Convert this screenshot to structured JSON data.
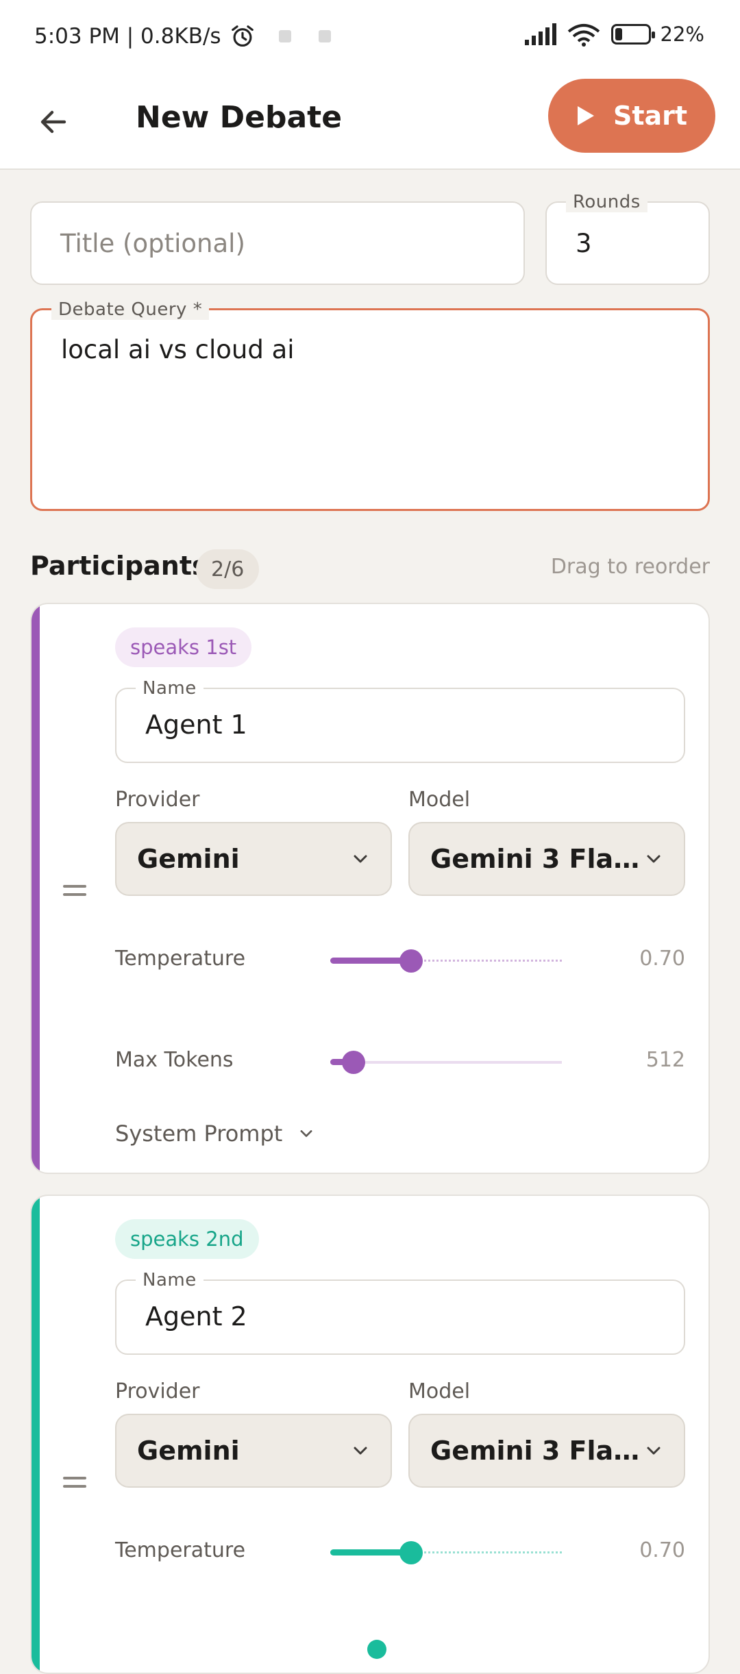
{
  "status_bar": {
    "time_text": "5:03 PM | 0.8KB/s",
    "battery_text": "22%",
    "battery_level": 0.22
  },
  "header": {
    "title": "New Debate",
    "start_label": "Start"
  },
  "form": {
    "title_placeholder": "Title (optional)",
    "rounds_label": "Rounds",
    "rounds_value": "3",
    "query_label": "Debate Query *",
    "query_value": "local ai vs cloud ai"
  },
  "participants": {
    "title": "Participants",
    "count": "2/6",
    "drag_hint": "Drag to reorder",
    "items": [
      {
        "speaks": "speaks 1st",
        "name_label": "Name",
        "name_value": "Agent 1",
        "provider_label": "Provider",
        "provider_value": "Gemini",
        "model_label": "Model",
        "model_value": "Gemini 3 Flas...",
        "temperature_label": "Temperature",
        "temperature_value": "0.70",
        "temperature_fraction": 0.35,
        "max_tokens_label": "Max Tokens",
        "max_tokens_value": "512",
        "max_tokens_fraction": 0.1,
        "system_prompt_label": "System Prompt",
        "accent_color": "#9b59b6",
        "badge_bg": "#f5eaf7"
      },
      {
        "speaks": "speaks 2nd",
        "name_label": "Name",
        "name_value": "Agent 2",
        "provider_label": "Provider",
        "provider_value": "Gemini",
        "model_label": "Model",
        "model_value": "Gemini 3 Flas...",
        "temperature_label": "Temperature",
        "temperature_value": "0.70",
        "temperature_fraction": 0.35,
        "accent_color": "#1abc9c",
        "badge_bg": "#e3f7f1"
      }
    ]
  },
  "colors": {
    "accent": "#dd7452",
    "agent1": "#9b59b6",
    "agent2": "#1abc9c"
  }
}
